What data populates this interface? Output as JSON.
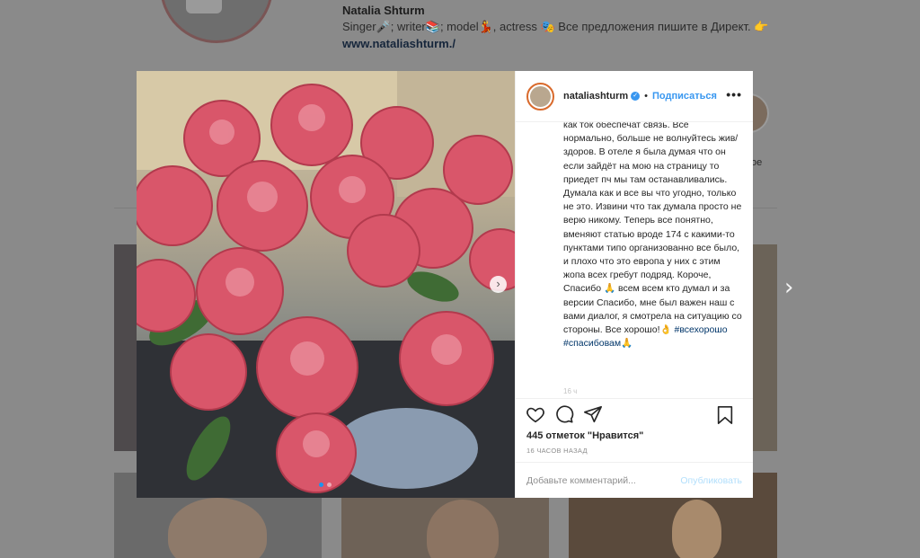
{
  "profile": {
    "name": "Natalia Shturm",
    "bio": "Singer🎤; writer📚; model💃, actress 🎭 Все предложения пишите в Директ. 👉",
    "link": "www.nataliashturm./",
    "highlight_label": "ое"
  },
  "post": {
    "username": "nataliashturm",
    "follow_label": "Подписаться",
    "caption": "как ток обеспечат связь. Все нормально, больше не волнуйтесь жив/здоров. В отеле я была думая что он если зайдёт на мою на страницу то приедет пч мы там останавливались. Думала как и все вы что угодно, только не это. Извини что так думала просто не верю никому. Теперь все понятно, вменяют статью вроде 174 с какими-то пунктами типо организованно все было, и плохо что это европа у них с этим жопа всех гребут подряд. Короче, Спасибо 🙏 всем всем кто думал и за версии Спасибо, мне был важен наш с вами диалог, я смотрела на ситуацию со стороны. Все хорошо!👌",
    "hashtag_1": "#всехорошо",
    "hashtag_2": "#спасибовам",
    "hashtag_2_emoji": "🙏",
    "caption_cut": "16 ч",
    "likes": "445 отметок \"Нравится\"",
    "time_ago": "16 ЧАСОВ НАЗАД",
    "comment_placeholder": "Добавьте комментарий...",
    "post_button": "Опубликовать",
    "carousel": {
      "slides": 2,
      "current": 1
    }
  },
  "icons": [
    "heart-icon",
    "comment-icon",
    "share-icon",
    "bookmark-icon",
    "more-icon",
    "verified-icon",
    "chevron-right-icon"
  ],
  "colors": {
    "accent": "#3897f0",
    "hashtag": "#003569",
    "post_disabled": "#b2dffc"
  }
}
